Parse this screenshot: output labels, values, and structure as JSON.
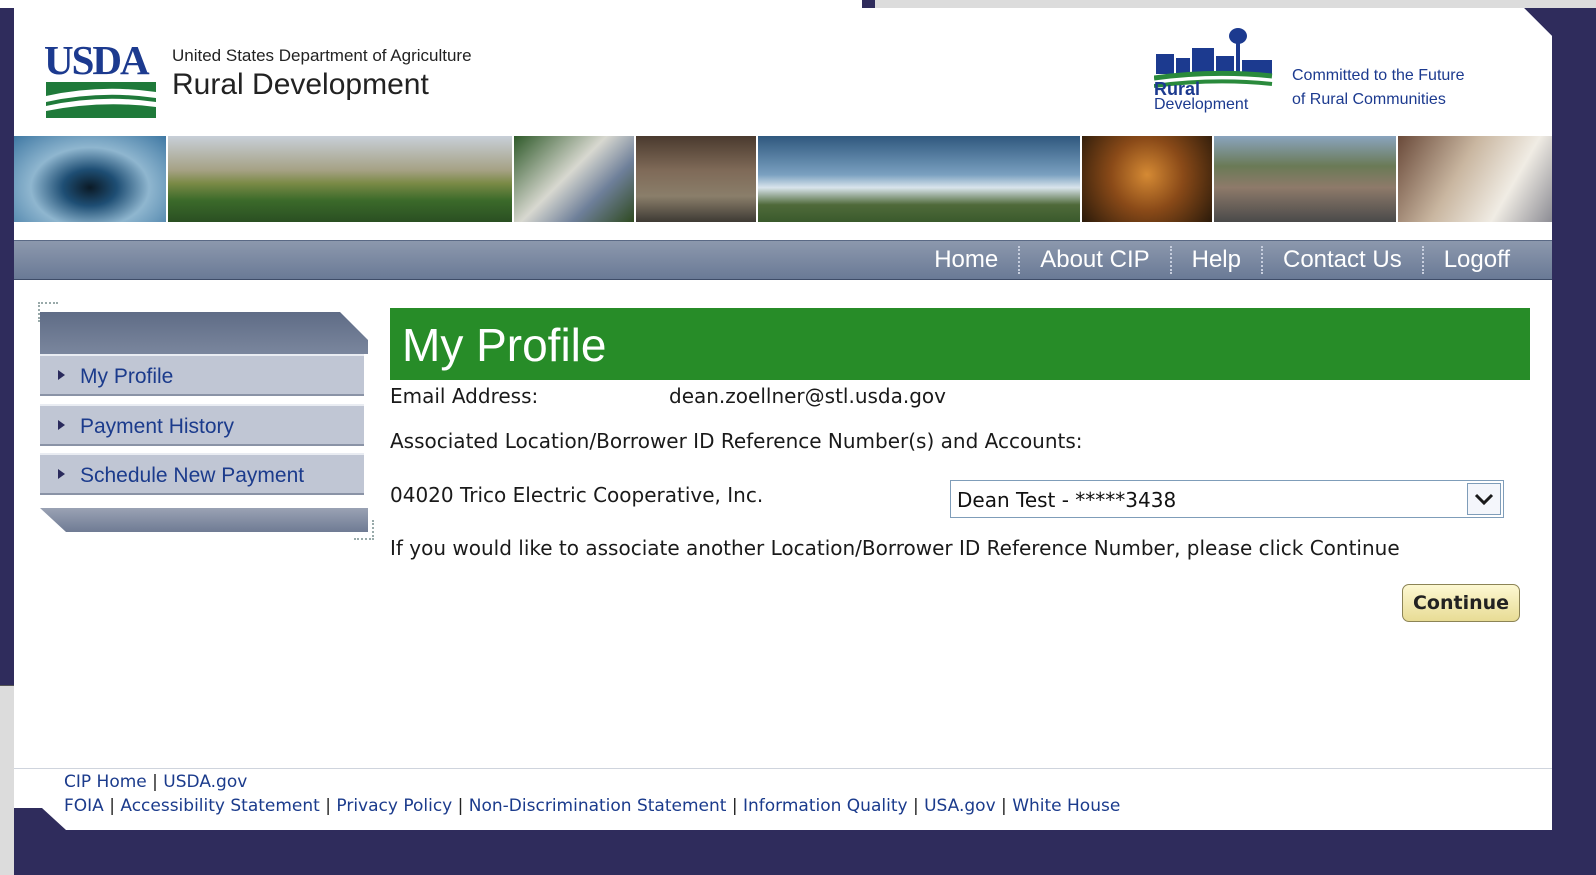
{
  "header": {
    "agency_logo": "USDA",
    "dept_name": "United States Department of Agriculture",
    "agency": "Rural Development",
    "rd_logo_line1": "Rural",
    "rd_logo_line2": "Development",
    "tagline_line1": "Committed to the Future",
    "tagline_line2": "of Rural Communities"
  },
  "nav": {
    "items": [
      "Home",
      "About CIP",
      "Help",
      "Contact Us",
      "Logoff"
    ]
  },
  "sidebar": {
    "items": [
      "My Profile",
      "Payment History",
      "Schedule New Payment"
    ]
  },
  "main": {
    "title": "My Profile",
    "email_label": "Email Address:",
    "email_value": "dean.zoellner@stl.usda.gov",
    "assoc_label": "Associated Location/Borrower ID Reference Number(s) and Accounts:",
    "location_value": "04020 Trico Electric Cooperative, Inc.",
    "account_selected": "Dean Test - *****3438",
    "prompt": "If you would like to associate another Location/Borrower ID Reference Number, please click Continue",
    "continue_label": "Continue"
  },
  "footer": {
    "links1": [
      "CIP Home",
      "USDA.gov"
    ],
    "links2": [
      "FOIA",
      "Accessibility Statement",
      "Privacy Policy",
      "Non-Discrimination Statement",
      "Information Quality",
      "USA.gov",
      "White House"
    ]
  },
  "colors": {
    "title_bar": "#278c28",
    "nav_bar": "#6a7a96",
    "link_blue": "#1b3b8c",
    "outer_bg": "#2f2c5c"
  }
}
